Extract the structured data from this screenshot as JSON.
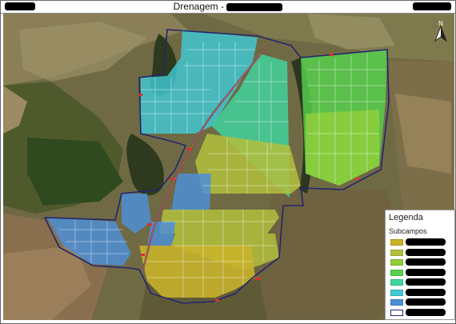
{
  "title": {
    "text": "Drenagem -"
  },
  "legend": {
    "title": "Legenda",
    "subtitle": "Subcampos",
    "items": [
      {
        "color": "#c9b32a",
        "label": ""
      },
      {
        "color": "#b3bf3d",
        "label": ""
      },
      {
        "color": "#8fcf3c",
        "label": ""
      },
      {
        "color": "#56d24d",
        "label": ""
      },
      {
        "color": "#3fd6a0",
        "label": ""
      },
      {
        "color": "#41c9d6",
        "label": ""
      },
      {
        "color": "#4d8fd6",
        "label": ""
      },
      {
        "color": "#ffffff",
        "label": ""
      }
    ]
  },
  "icons": {
    "north": "north-arrow-icon"
  },
  "colors": {
    "zone_yellow": "#c9b32a",
    "zone_olive": "#b3bf3d",
    "zone_lime": "#8fcf3c",
    "zone_green": "#56d24d",
    "zone_mint": "#3fd6a0",
    "zone_cyan": "#41c9d6",
    "zone_blue": "#4d8fd6",
    "boundary": "#2a2a7a",
    "road": "#7a2a3a"
  }
}
